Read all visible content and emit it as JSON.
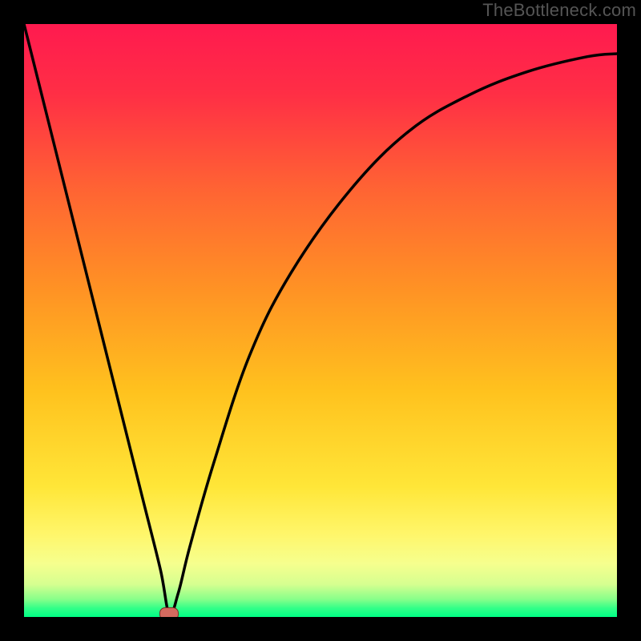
{
  "watermark": "TheBottleneck.com",
  "colors": {
    "black": "#000000",
    "curve": "#000000",
    "marker_fill": "#d46a5f",
    "marker_border": "#7a2e24",
    "gradient_stops": [
      {
        "offset": 0.0,
        "color": "#ff1a4f"
      },
      {
        "offset": 0.12,
        "color": "#ff2f45"
      },
      {
        "offset": 0.28,
        "color": "#ff6433"
      },
      {
        "offset": 0.45,
        "color": "#ff9324"
      },
      {
        "offset": 0.62,
        "color": "#ffc21e"
      },
      {
        "offset": 0.78,
        "color": "#ffe638"
      },
      {
        "offset": 0.86,
        "color": "#fff66a"
      },
      {
        "offset": 0.91,
        "color": "#f6ff8e"
      },
      {
        "offset": 0.945,
        "color": "#d6ff90"
      },
      {
        "offset": 0.97,
        "color": "#88ff8a"
      },
      {
        "offset": 0.985,
        "color": "#33ff88"
      },
      {
        "offset": 1.0,
        "color": "#00ff85"
      }
    ]
  },
  "chart_data": {
    "type": "line",
    "title": "",
    "xlabel": "",
    "ylabel": "",
    "xlim": [
      0,
      100
    ],
    "ylim": [
      0,
      100
    ],
    "series": [
      {
        "name": "bottleneck-curve",
        "x": [
          0,
          2,
          5,
          10,
          15,
          20,
          23,
          24.5,
          26,
          28,
          32,
          38,
          45,
          55,
          65,
          75,
          85,
          95,
          100
        ],
        "y": [
          100,
          92,
          80,
          60,
          40,
          20,
          8,
          0.5,
          4,
          12,
          26,
          44,
          58,
          72,
          82,
          88,
          92,
          94.5,
          95
        ]
      }
    ],
    "annotations": [
      {
        "name": "optimal-point",
        "x": 24.5,
        "y": 0.5
      }
    ]
  }
}
